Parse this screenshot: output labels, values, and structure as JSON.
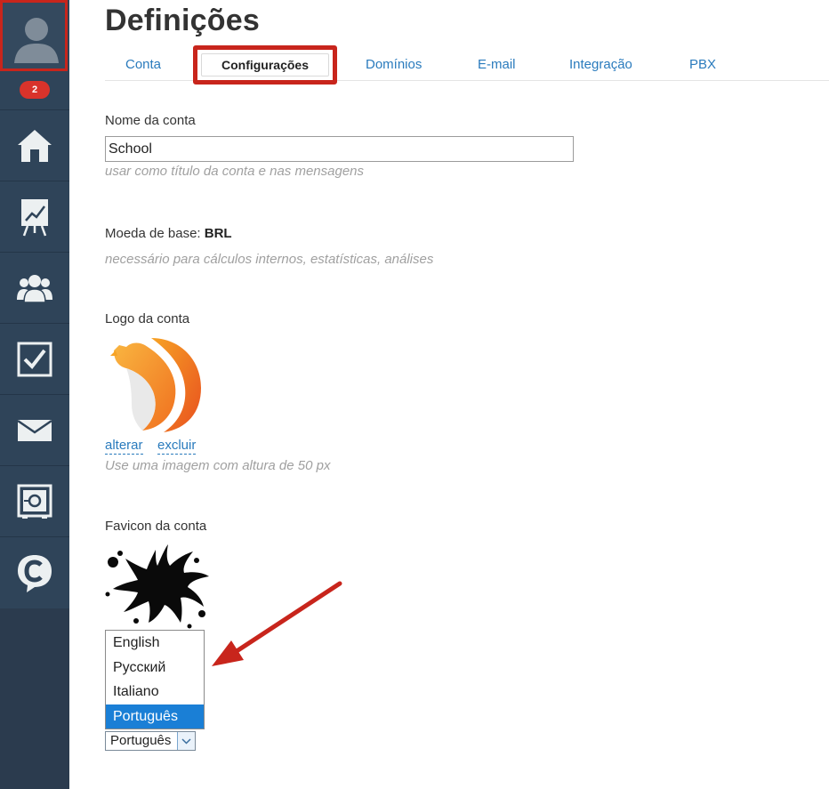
{
  "sidebar": {
    "badge_count": "2",
    "items": [
      {
        "name": "home",
        "icon": "home-icon"
      },
      {
        "name": "reports",
        "icon": "chart-board-icon"
      },
      {
        "name": "contacts",
        "icon": "people-icon"
      },
      {
        "name": "tasks",
        "icon": "checkbox-icon"
      },
      {
        "name": "mail",
        "icon": "envelope-icon"
      },
      {
        "name": "safe",
        "icon": "safe-icon"
      },
      {
        "name": "chat",
        "icon": "chat-c-icon"
      }
    ],
    "colors": {
      "background": "#2f4459",
      "highlight": "#c8251c",
      "badge": "#d9332b"
    }
  },
  "header": {
    "title": "Definições",
    "tabs": [
      {
        "label": "Conta",
        "active": false
      },
      {
        "label": "Configurações",
        "active": true
      },
      {
        "label": "Domínios",
        "active": false
      },
      {
        "label": "E-mail",
        "active": false
      },
      {
        "label": "Integração",
        "active": false
      },
      {
        "label": "PBX",
        "active": false
      }
    ]
  },
  "form": {
    "account_name": {
      "label": "Nome da conta",
      "value": "School",
      "hint": "usar como título da conta e nas mensagens"
    },
    "currency": {
      "label": "Moeda de base:",
      "value": "BRL",
      "hint": "necessário para cálculos internos, estatísticas, análises"
    },
    "logo": {
      "label": "Logo da conta",
      "change_link": "alterar",
      "delete_link": "excluir",
      "hint": "Use uma imagem com altura de 50 px"
    },
    "favicon": {
      "label": "Favicon da conta"
    },
    "language": {
      "options": [
        "English",
        "Русский",
        "Italiano",
        "Português"
      ],
      "selected": "Português"
    }
  },
  "colors": {
    "link": "#2a7bbd",
    "selection": "#1a7fd6",
    "annotation": "#c8251c"
  }
}
